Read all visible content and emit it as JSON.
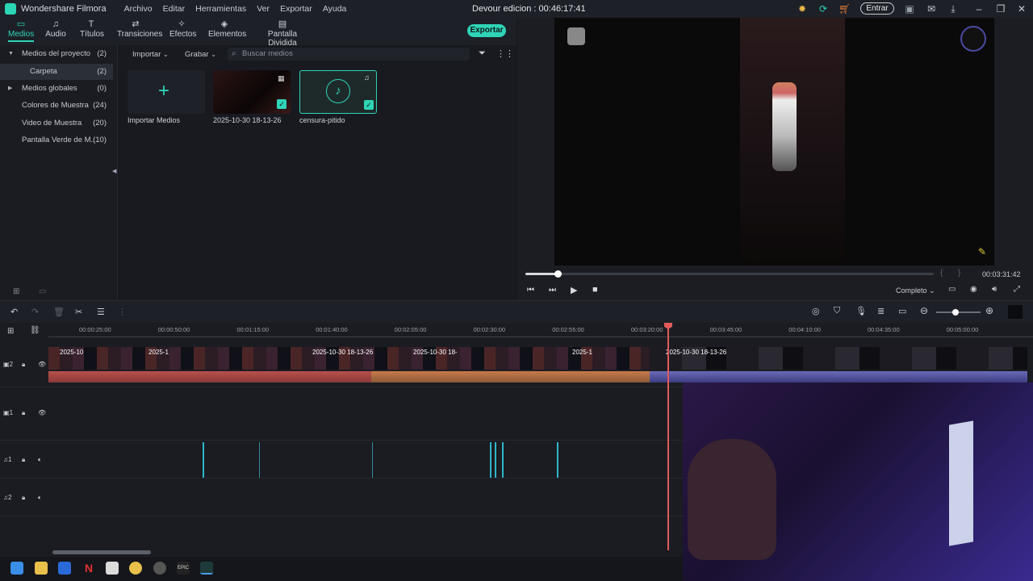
{
  "titlebar": {
    "app_name": "Wondershare Filmora",
    "menu": [
      "Archivo",
      "Editar",
      "Herramientas",
      "Ver",
      "Exportar",
      "Ayuda"
    ],
    "document_title": "Devour edicion : 00:46:17:41",
    "login_label": "Entrar"
  },
  "tabs": [
    {
      "label": "Medios",
      "icon": "folder-icon",
      "active": true
    },
    {
      "label": "Audio",
      "icon": "music-icon",
      "active": false
    },
    {
      "label": "Títulos",
      "icon": "text-icon",
      "active": false
    },
    {
      "label": "Transiciones",
      "icon": "transition-icon",
      "active": false
    },
    {
      "label": "Efectos",
      "icon": "effects-icon",
      "active": false
    },
    {
      "label": "Elementos",
      "icon": "elements-icon",
      "active": false
    },
    {
      "label": "Pantalla Dividida",
      "icon": "split-screen-icon",
      "active": false
    }
  ],
  "export_label": "Exportar",
  "sidebar": {
    "items": [
      {
        "label": "Medios del proyecto",
        "count": "(2)",
        "arrow": "▼"
      },
      {
        "label": "Carpeta",
        "count": "(2)",
        "arrow": ""
      },
      {
        "label": "Medios globales",
        "count": "(0)",
        "arrow": "▶"
      },
      {
        "label": "Colores de Muestra",
        "count": "(24)",
        "arrow": ""
      },
      {
        "label": "Video de Muestra",
        "count": "(20)",
        "arrow": ""
      },
      {
        "label": "Pantalla Verde de M...",
        "count": "(10)",
        "arrow": ""
      }
    ]
  },
  "media": {
    "import_label": "Importar",
    "record_label": "Grabar",
    "search_placeholder": "Buscar medios",
    "items": [
      {
        "label": "Importar Medios"
      },
      {
        "label": "2025-10-30 18-13-26"
      },
      {
        "label": "censura-pitido"
      }
    ]
  },
  "preview": {
    "timecode": "00:03:31:42",
    "quality": "Completo",
    "progress": 0.08
  },
  "timeline": {
    "ruler_ticks": [
      "00:00:25:00",
      "00:00:50:00",
      "00:01:15:00",
      "00:01:40:00",
      "00:02:05:00",
      "00:02:30:00",
      "00:02:55:00",
      "00:03:20:00",
      "00:03:45:00",
      "00:04:10:00",
      "00:04:35:00",
      "00:05:00:00"
    ],
    "clip_labels": [
      "2025-10",
      "2025-1",
      "2025-10-30 18-13-26",
      "2025-10-30 18-",
      "2025-1",
      "2025-10-30 18-13-26"
    ],
    "tracks": [
      {
        "id": "2",
        "type": "video"
      },
      {
        "id": "1",
        "type": "video"
      },
      {
        "id": "1",
        "type": "audio"
      },
      {
        "id": "2",
        "type": "audio"
      }
    ]
  },
  "colors": {
    "accent": "#2fd4b8",
    "playhead": "#e05a5a",
    "audio_wave": "#c0504f"
  }
}
